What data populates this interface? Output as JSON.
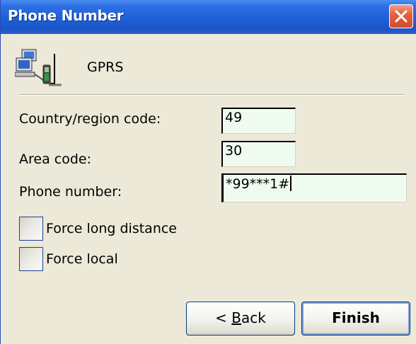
{
  "window": {
    "title": "Phone Number"
  },
  "connection": {
    "icon": "network-connection-icon",
    "name": "GPRS"
  },
  "fields": {
    "country_code": {
      "label": "Country/region code:",
      "value": "49"
    },
    "area_code": {
      "label": "Area code:",
      "value": "30"
    },
    "phone_number": {
      "label": "Phone number:",
      "value": "*99***1#"
    }
  },
  "options": {
    "force_long_distance": {
      "label": "Force long distance",
      "checked": false
    },
    "force_local": {
      "label": "Force local",
      "checked": false
    }
  },
  "buttons": {
    "back": {
      "prefix": "< ",
      "mnemonic": "B",
      "rest": "ack"
    },
    "finish": "Finish"
  },
  "colors": {
    "titlebar": "#1f5fd6",
    "close": "#d44a2a",
    "input_bg": "#f0fbf0",
    "dialog_bg": "#ece9d8"
  }
}
